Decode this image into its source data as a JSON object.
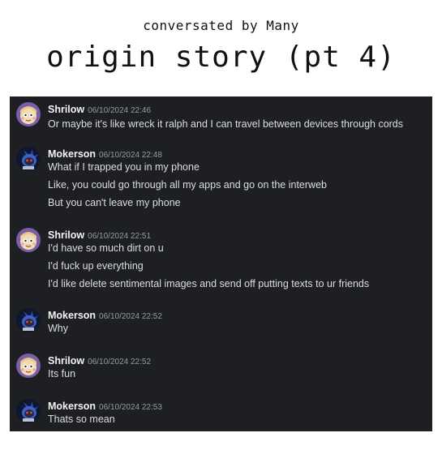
{
  "caption": {
    "credit": "conversated by Many",
    "title": "origin story (pt 4)"
  },
  "messages": [
    {
      "author": "Shrilow",
      "timestamp": "06/10/2024 22:46",
      "avatar": "shrilow-avatar",
      "lines": [
        "Or maybe it's like wreck it ralph and I can travel between devices through cords"
      ]
    },
    {
      "author": "Mokerson",
      "timestamp": "06/10/2024 22:48",
      "avatar": "mokerson-avatar",
      "lines": [
        "What if I trapped you in my phone",
        "Like, you could go through all my apps and go on the interweb",
        "But you can't leave my phone"
      ]
    },
    {
      "author": "Shrilow",
      "timestamp": "06/10/2024 22:51",
      "avatar": "shrilow-avatar",
      "lines": [
        "I'd have so much dirt on u",
        "I'd fuck up everything",
        "I'd like delete sentimental images and send off putting texts to ur friends"
      ]
    },
    {
      "author": "Mokerson",
      "timestamp": "06/10/2024 22:52",
      "avatar": "mokerson-avatar",
      "lines": [
        "Why"
      ]
    },
    {
      "author": "Shrilow",
      "timestamp": "06/10/2024 22:52",
      "avatar": "shrilow-avatar",
      "lines": [
        "Its fun"
      ]
    },
    {
      "author": "Mokerson",
      "timestamp": "06/10/2024 22:53",
      "avatar": "mokerson-avatar",
      "lines": [
        "Thats so mean"
      ]
    }
  ],
  "colors": {
    "chat_background": "#1e1f22",
    "username": "#f2f3f5",
    "message_text": "#dbdee1",
    "timestamp": "#949ba4"
  }
}
